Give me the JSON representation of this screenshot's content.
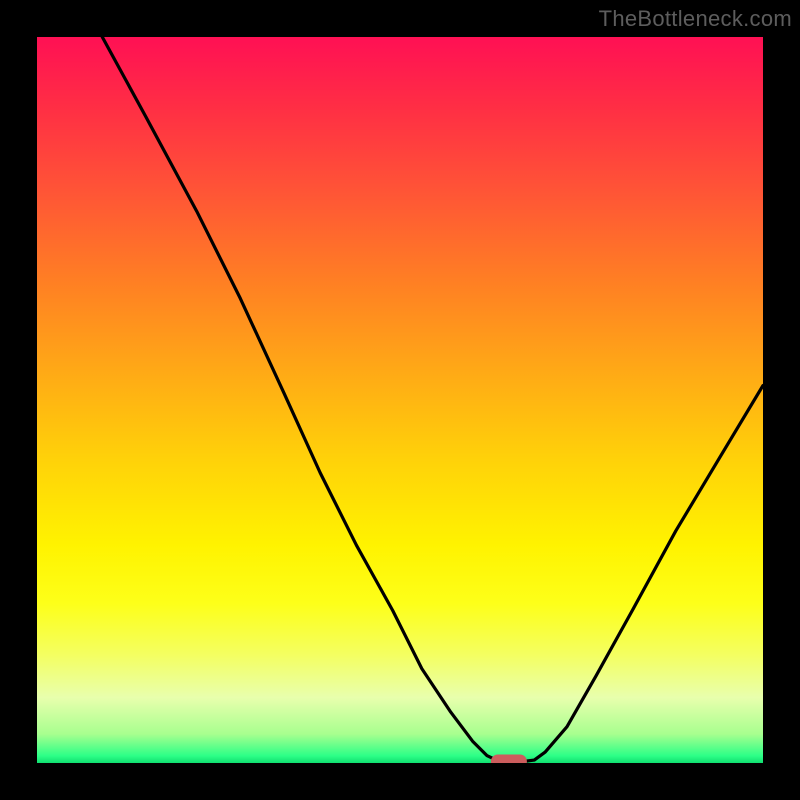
{
  "watermark": "TheBottleneck.com",
  "chart_data": {
    "type": "line",
    "title": "",
    "xlabel": "",
    "ylabel": "",
    "xlim": [
      0,
      100
    ],
    "ylim": [
      0,
      100
    ],
    "grid": false,
    "legend": false,
    "series": [
      {
        "name": "bottleneck-curve",
        "x": [
          9,
          15,
          22,
          28,
          34,
          39,
          44,
          49,
          53,
          57,
          60,
          62,
          63.5,
          65,
          67,
          68.5,
          70,
          73,
          77,
          82,
          88,
          94,
          100
        ],
        "y": [
          100,
          89,
          76,
          64,
          51,
          40,
          30,
          21,
          13,
          7,
          3,
          1,
          0.3,
          0.2,
          0.2,
          0.4,
          1.5,
          5,
          12,
          21,
          32,
          42,
          52
        ]
      }
    ],
    "marker": {
      "name": "optimal-point",
      "x": 65,
      "y": 0.2,
      "color": "#cc5d5d"
    },
    "background_gradient": {
      "type": "vertical",
      "stops": [
        {
          "pos": 0,
          "color": "#ff1054"
        },
        {
          "pos": 50,
          "color": "#ffd109"
        },
        {
          "pos": 85,
          "color": "#f4ff60"
        },
        {
          "pos": 100,
          "color": "#10df70"
        }
      ]
    }
  }
}
